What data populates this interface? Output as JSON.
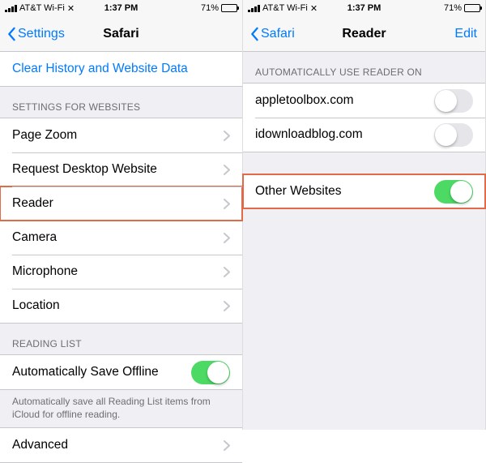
{
  "status": {
    "carrier": "AT&T Wi-Fi",
    "time": "1:37 PM",
    "battery_pct": "71%"
  },
  "left": {
    "nav_back": "Settings",
    "nav_title": "Safari",
    "clear_history": "Clear History and Website Data",
    "group_websites_header": "SETTINGS FOR WEBSITES",
    "rows": {
      "page_zoom": "Page Zoom",
      "request_desktop": "Request Desktop Website",
      "reader": "Reader",
      "camera": "Camera",
      "microphone": "Microphone",
      "location": "Location"
    },
    "group_reading_header": "READING LIST",
    "auto_save_offline": "Automatically Save Offline",
    "auto_save_offline_on": true,
    "reading_footer": "Automatically save all Reading List items from iCloud for offline reading.",
    "advanced": "Advanced"
  },
  "right": {
    "nav_back": "Safari",
    "nav_title": "Reader",
    "nav_edit": "Edit",
    "group_auto_header": "AUTOMATICALLY USE READER ON",
    "sites": [
      {
        "domain": "appletoolbox.com",
        "on": false
      },
      {
        "domain": "idownloadblog.com",
        "on": false
      }
    ],
    "other_websites": "Other Websites",
    "other_websites_on": true
  }
}
